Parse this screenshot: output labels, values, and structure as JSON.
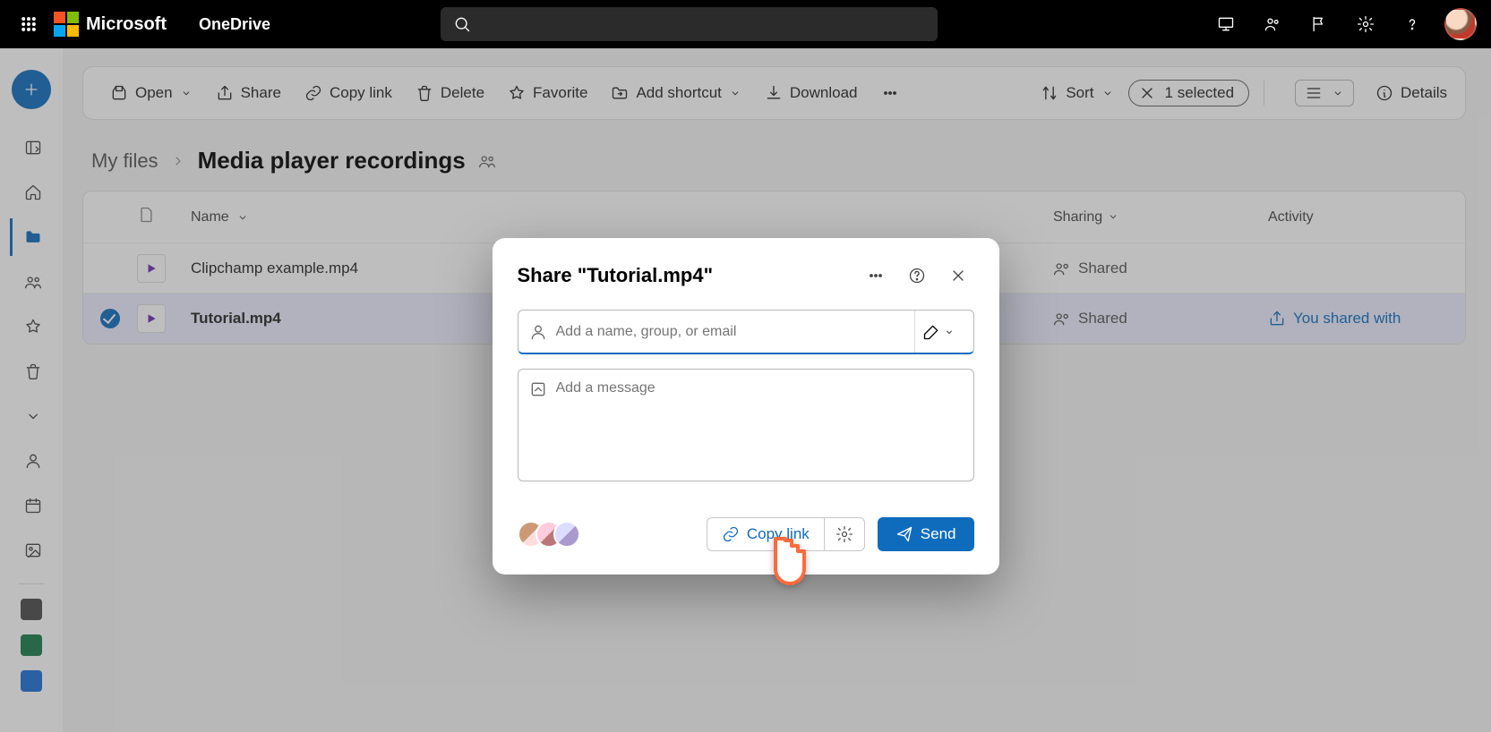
{
  "header": {
    "brand": "Microsoft",
    "app": "OneDrive"
  },
  "toolbar": {
    "open": "Open",
    "share": "Share",
    "copylink": "Copy link",
    "delete": "Delete",
    "favorite": "Favorite",
    "addshortcut": "Add shortcut",
    "download": "Download",
    "sort": "Sort",
    "selected": "1 selected",
    "details": "Details"
  },
  "breadcrumb": {
    "root": "My files",
    "current": "Media player recordings"
  },
  "columns": {
    "name": "Name",
    "sharing": "Sharing",
    "activity": "Activity"
  },
  "files": [
    {
      "name": "Clipchamp example.mp4",
      "sharing": "Shared",
      "activity": ""
    },
    {
      "name": "Tutorial.mp4",
      "sharing": "Shared",
      "activity": "You shared with"
    }
  ],
  "modal": {
    "title": "Share \"Tutorial.mp4\"",
    "recipient_placeholder": "Add a name, group, or email",
    "message_placeholder": "Add a message",
    "copylink": "Copy link",
    "send": "Send"
  }
}
